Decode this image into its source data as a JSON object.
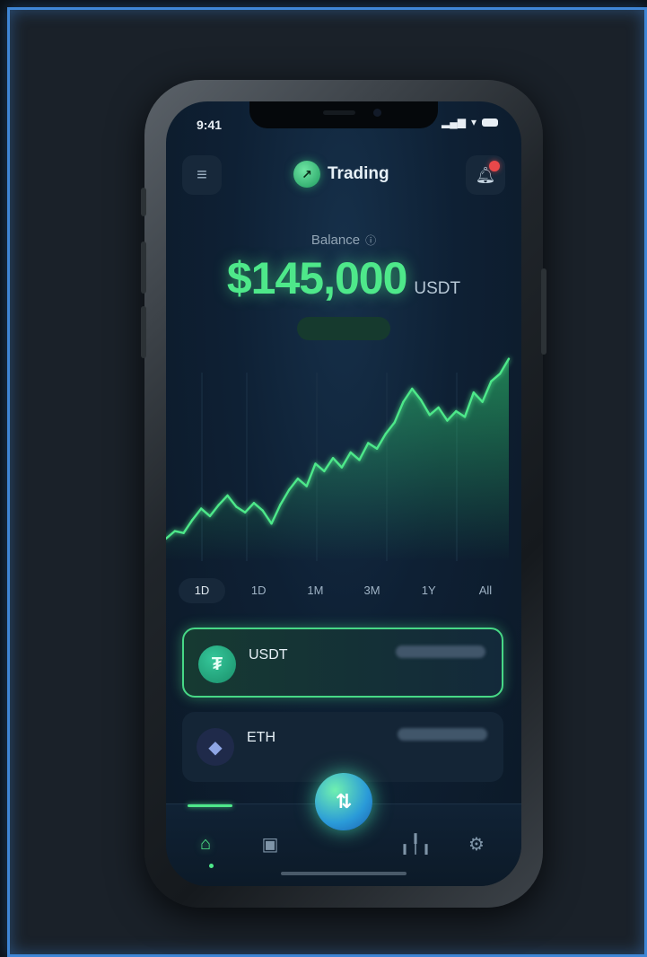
{
  "status_bar": {
    "time": "9:41",
    "signal_icon": "signal-icon",
    "wifi_icon": "wifi-icon",
    "battery_icon": "battery-icon"
  },
  "header": {
    "menu_icon": "menu-icon",
    "app_title": "Trading",
    "logo_icon": "trading-logo-icon",
    "notification_icon": "bell-icon",
    "has_notification": true
  },
  "balance": {
    "label": "Balance",
    "amount": "$145,000",
    "unit": "USDT"
  },
  "chart_data": {
    "type": "line",
    "x": [
      0,
      1,
      2,
      3,
      4,
      5,
      6,
      7,
      8,
      9,
      10,
      11,
      12,
      13,
      14,
      15,
      16,
      17,
      18,
      19,
      20,
      21,
      22,
      23,
      24,
      25,
      26,
      27,
      28,
      29,
      30,
      31,
      32,
      33,
      34,
      35,
      36,
      37,
      38,
      39
    ],
    "values": [
      12,
      16,
      15,
      22,
      28,
      24,
      30,
      35,
      29,
      26,
      31,
      27,
      20,
      30,
      38,
      44,
      40,
      52,
      48,
      55,
      50,
      58,
      54,
      63,
      60,
      68,
      74,
      85,
      92,
      86,
      78,
      82,
      75,
      80,
      77,
      90,
      85,
      96,
      100,
      108
    ],
    "color": "#4ee88a",
    "ylim": [
      0,
      115
    ]
  },
  "periods": {
    "active_index": 0,
    "items": [
      "1D",
      "1D",
      "1M",
      "3M",
      "1Y",
      "All"
    ]
  },
  "assets": [
    {
      "symbol": "USDT",
      "icon": "tether-icon",
      "highlight": true
    },
    {
      "symbol": "ETH",
      "icon": "ethereum-icon",
      "highlight": false
    }
  ],
  "tabbar": {
    "items": [
      {
        "icon": "home-icon",
        "active": true
      },
      {
        "icon": "wallet-icon",
        "active": false
      },
      {
        "icon": "trade-swap-icon",
        "active": false
      },
      {
        "icon": "stats-icon",
        "active": false
      },
      {
        "icon": "settings-icon",
        "active": false
      }
    ]
  },
  "colors": {
    "accent_green": "#4ee88a",
    "frame_blue": "#3f86d6",
    "screen_bg": "#0e2034",
    "notification_red": "#e8484a"
  }
}
